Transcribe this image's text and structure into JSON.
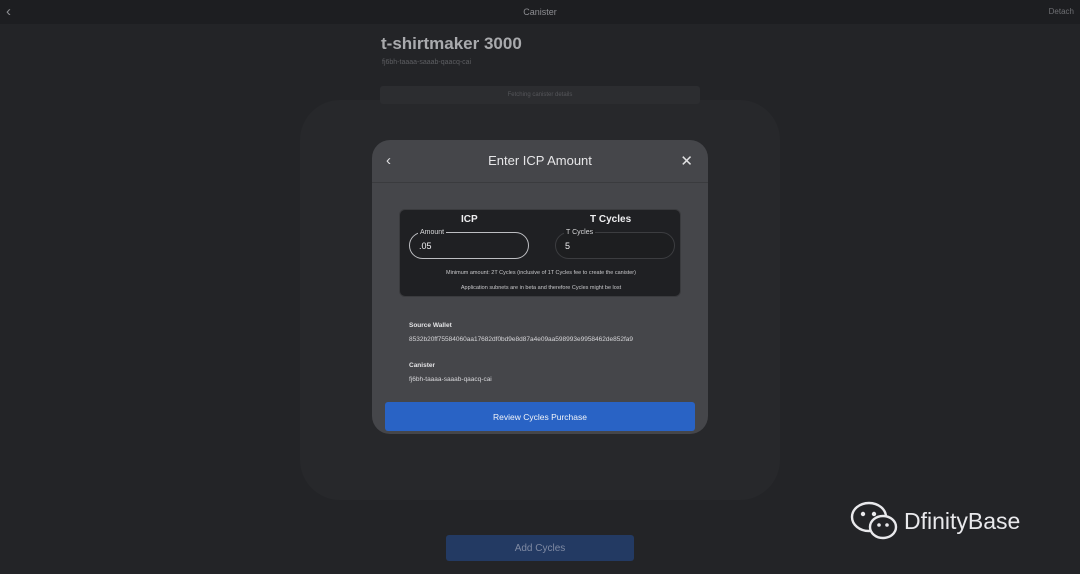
{
  "topbar": {
    "title": "Canister",
    "detach": "Detach"
  },
  "background": {
    "canister_name": "t-shirtmaker 3000",
    "canister_id": "fj6bh-taaaa-saaab-qaacq-cai",
    "loading_text": "Fetching canister details",
    "add_cycles_label": "Add Cycles"
  },
  "modal": {
    "title": "Enter ICP Amount",
    "icp_header": "ICP",
    "cycles_header": "T Cycles",
    "amount_label": "Amount",
    "amount_value": ".05",
    "cycles_label": "T Cycles",
    "cycles_value": "5",
    "note_min": "Minimum amount: 2T Cycles (inclusive of 1T Cycles fee to create the canister)",
    "note_beta": "Application subnets are in beta and therefore Cycles might be lost",
    "source_wallet_label": "Source Wallet",
    "source_wallet_value": "8532b20ff75584060aa17682df0bd9e8d87a4e09aa598993e9958462de852fa9",
    "canister_label": "Canister",
    "canister_value": "fj6bh-taaaa-saaab-qaacq-cai",
    "review_label": "Review Cycles Purchase"
  },
  "watermark": {
    "text": "DfinityBase"
  },
  "icons": {
    "back": "chevron-left-icon",
    "close": "close-icon",
    "wechat": "wechat-icon"
  },
  "colors": {
    "accent": "#2963c5",
    "modal_bg": "#45464a",
    "page_bg": "#232427"
  }
}
